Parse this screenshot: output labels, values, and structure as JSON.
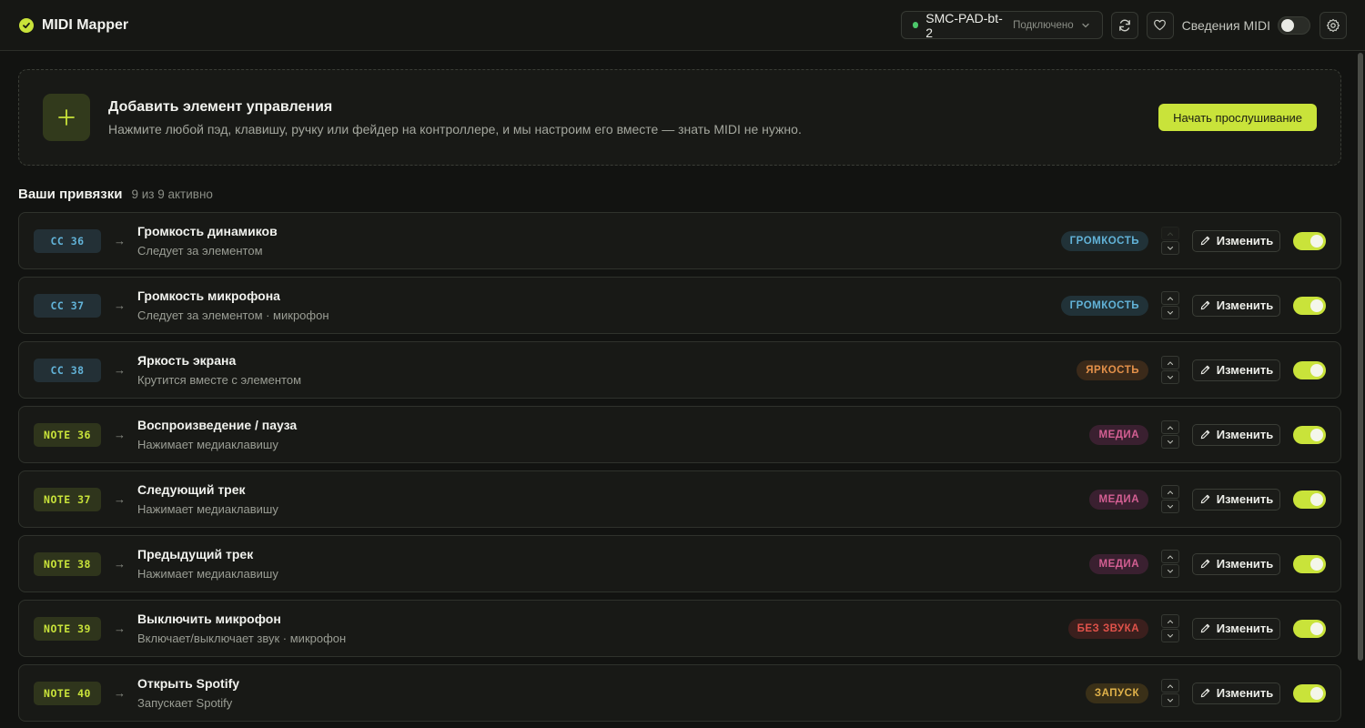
{
  "app": {
    "title": "MIDI Mapper"
  },
  "header": {
    "device": {
      "name": "SMC-PAD-bt-2",
      "status": "Подключено"
    },
    "midi_info_label": "Сведения MIDI"
  },
  "add_card": {
    "title": "Добавить элемент управления",
    "description": "Нажмите любой пэд, клавишу, ручку или фейдер на контроллере, и мы настроим его вместе — знать MIDI не нужно.",
    "button_label": "Начать прослушивание"
  },
  "section": {
    "title": "Ваши привязки",
    "count": "9 из 9 активно"
  },
  "edit_label": "Изменить",
  "arrow": "→",
  "bindings": [
    {
      "trigger": "CC 36",
      "kind": "cc",
      "title": "Громкость динамиков",
      "subtitle": "Следует за элементом",
      "tag": "ГРОМКОСТЬ",
      "tag_kind": "volume",
      "enabled": true
    },
    {
      "trigger": "CC 37",
      "kind": "cc",
      "title": "Громкость микрофона",
      "subtitle": "Следует за элементом · микрофон",
      "tag": "ГРОМКОСТЬ",
      "tag_kind": "volume",
      "enabled": true
    },
    {
      "trigger": "CC 38",
      "kind": "cc",
      "title": "Яркость экрана",
      "subtitle": "Крутится вместе с элементом",
      "tag": "ЯРКОСТЬ",
      "tag_kind": "bright",
      "enabled": true
    },
    {
      "trigger": "NOTE 36",
      "kind": "note",
      "title": "Воспроизведение / пауза",
      "subtitle": "Нажимает медиаклавишу",
      "tag": "МЕДИА",
      "tag_kind": "media",
      "enabled": true
    },
    {
      "trigger": "NOTE 37",
      "kind": "note",
      "title": "Следующий трек",
      "subtitle": "Нажимает медиаклавишу",
      "tag": "МЕДИА",
      "tag_kind": "media",
      "enabled": true
    },
    {
      "trigger": "NOTE 38",
      "kind": "note",
      "title": "Предыдущий трек",
      "subtitle": "Нажимает медиаклавишу",
      "tag": "МЕДИА",
      "tag_kind": "media",
      "enabled": true
    },
    {
      "trigger": "NOTE 39",
      "kind": "note",
      "title": "Выключить микрофон",
      "subtitle": "Включает/выключает звук · микрофон",
      "tag": "БЕЗ ЗВУКА",
      "tag_kind": "mute",
      "enabled": true
    },
    {
      "trigger": "NOTE 40",
      "kind": "note",
      "title": "Открыть Spotify",
      "subtitle": "Запускает Spotify",
      "tag": "ЗАПУСК",
      "tag_kind": "launch",
      "enabled": true
    }
  ],
  "colors": {
    "accent": "#c9e33a",
    "background": "#121311",
    "status_connected": "#4cc76a"
  },
  "icons": [
    "logo-icon",
    "chevron-down-icon",
    "sync-icon",
    "heart-icon",
    "settings-icon",
    "plus-icon",
    "chevron-up-icon",
    "pencil-icon"
  ]
}
